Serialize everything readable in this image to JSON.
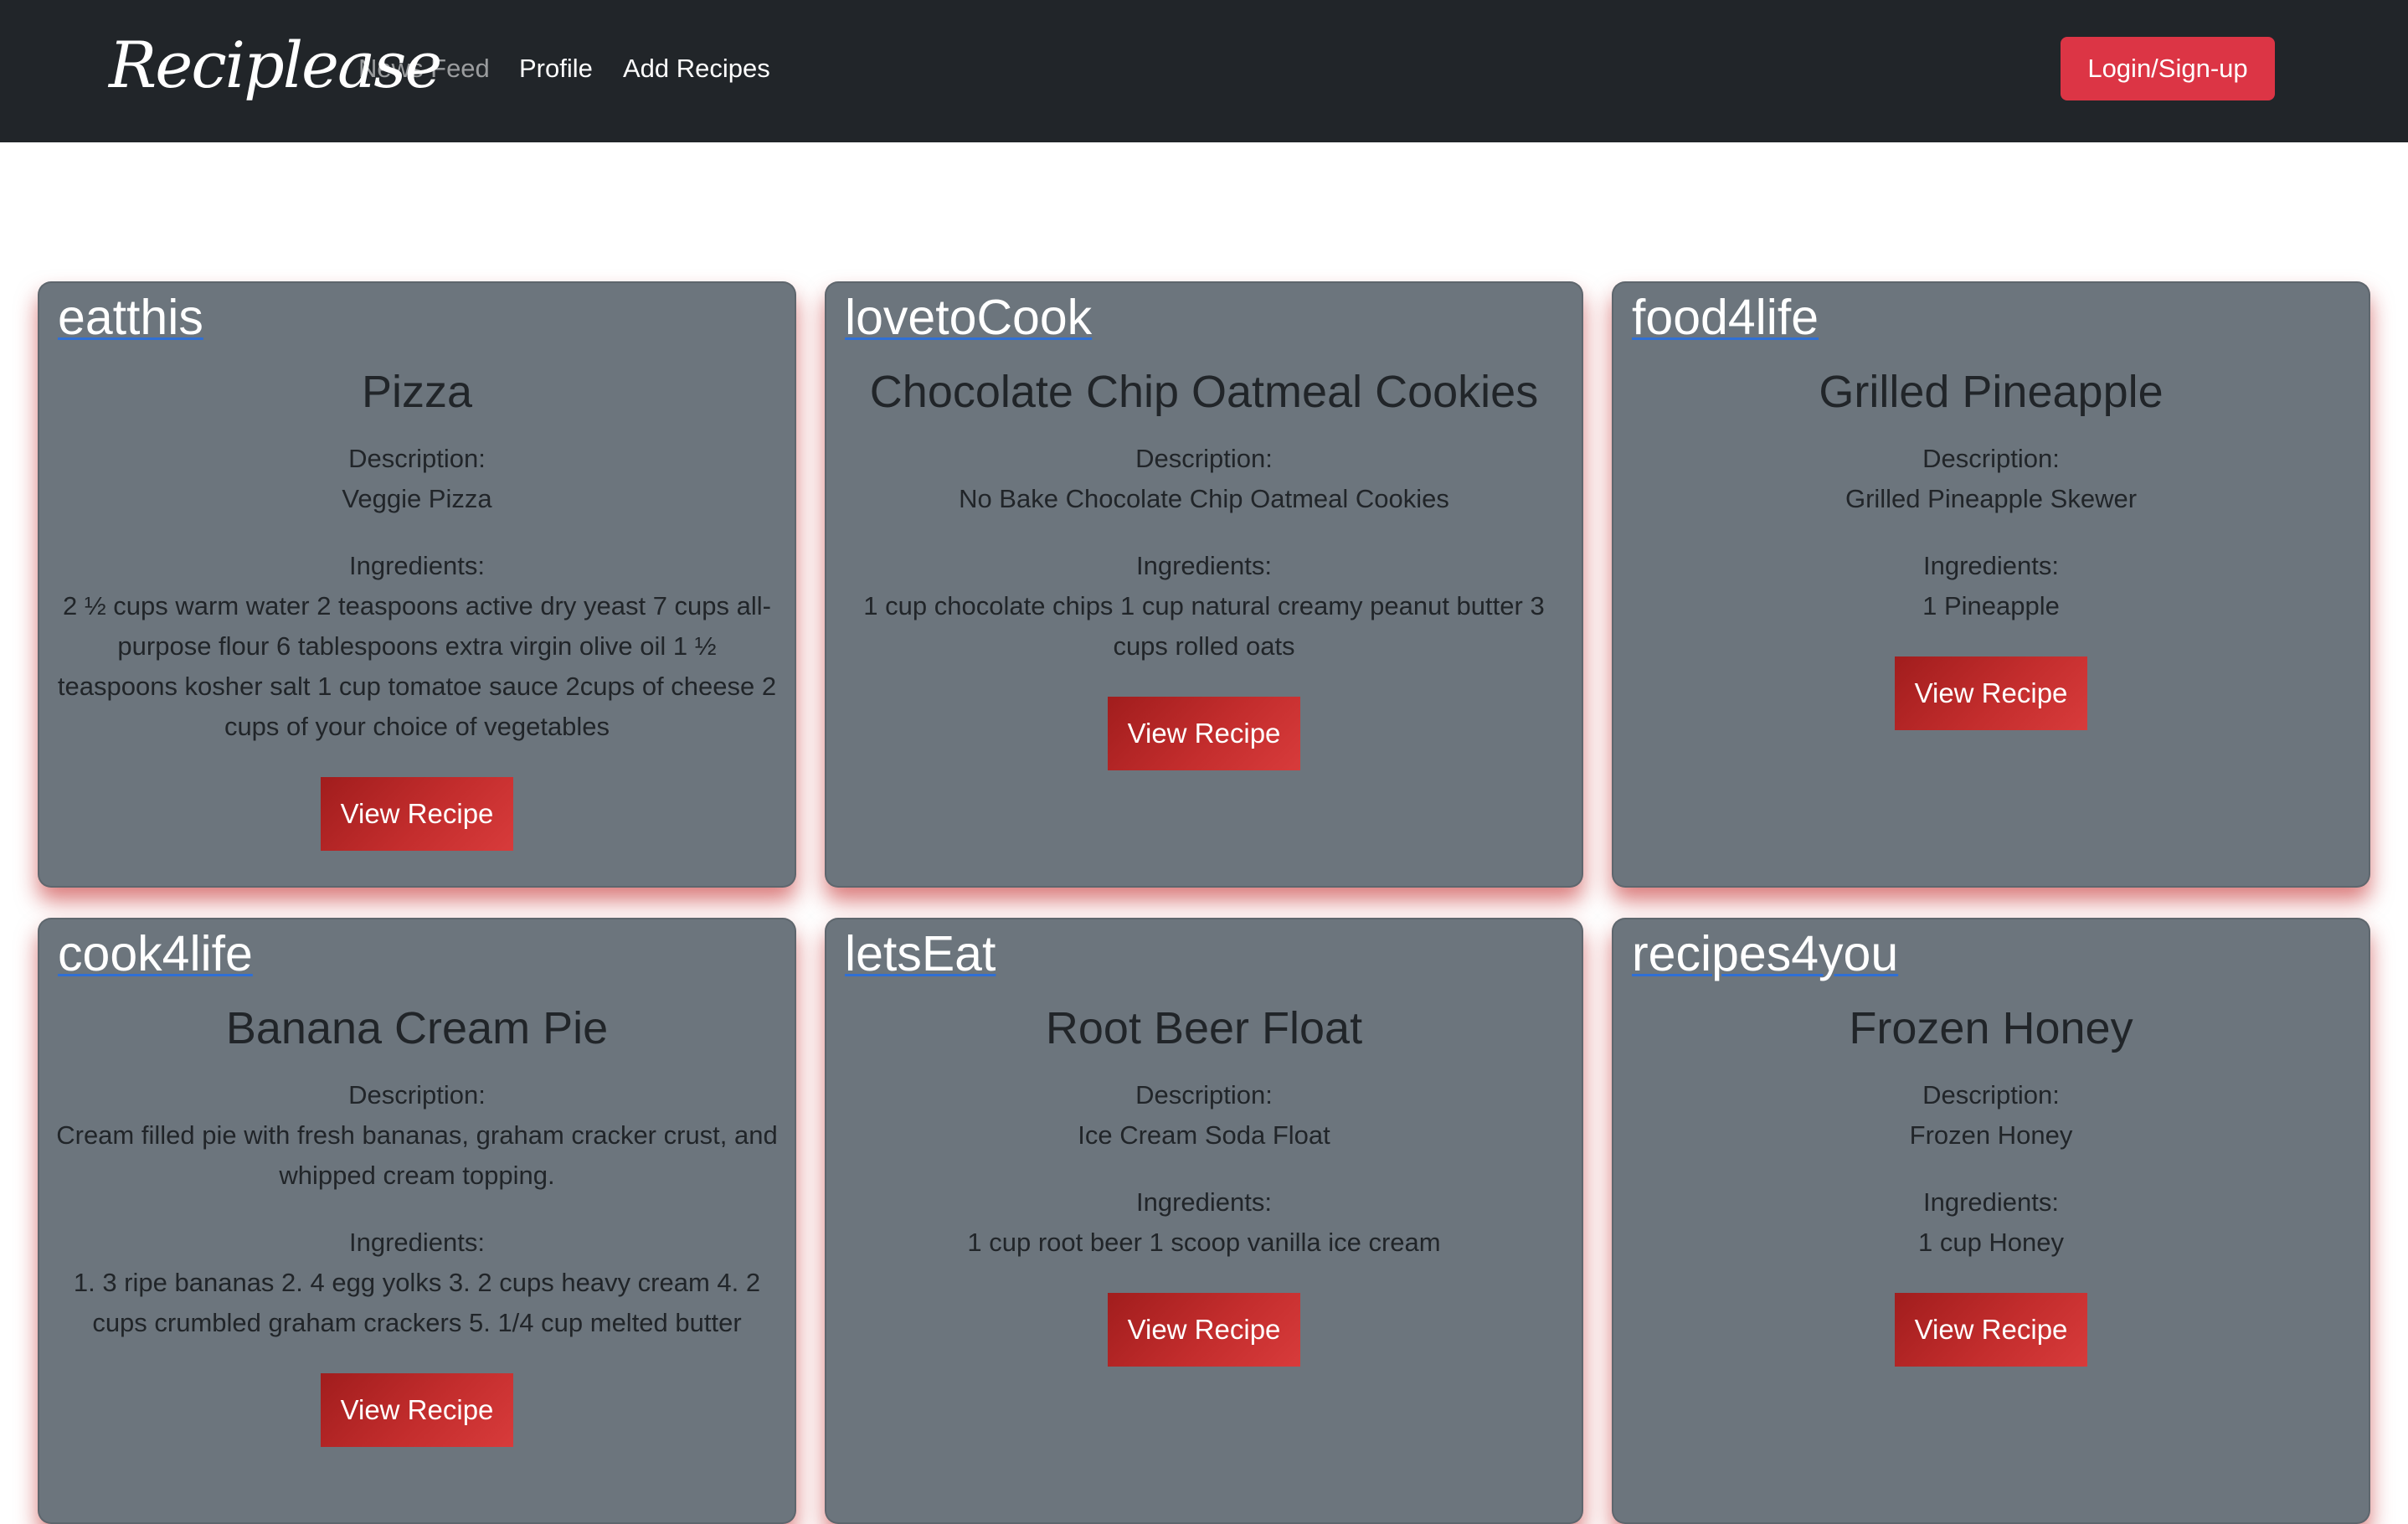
{
  "nav": {
    "brand": "Reciplease",
    "links": [
      "News Feed",
      "Profile",
      "Add Recipes"
    ],
    "login": "Login/Sign-up"
  },
  "labels": {
    "description": "Description:",
    "ingredients": "Ingredients:",
    "view_button": "View Recipe"
  },
  "cards": [
    {
      "user": "eatthis",
      "title": "Pizza",
      "description": "Veggie Pizza",
      "ingredients": "2 ½ cups warm water 2 teaspoons active dry yeast 7 cups all-purpose flour 6 tablespoons extra virgin olive oil 1 ½ teaspoons kosher salt 1 cup tomatoe sauce 2cups of cheese 2 cups of your choice of vegetables"
    },
    {
      "user": "lovetoCook",
      "title": "Chocolate Chip Oatmeal Cookies",
      "description": "No Bake Chocolate Chip Oatmeal Cookies",
      "ingredients": "1 cup chocolate chips 1 cup natural creamy peanut butter 3 cups rolled oats"
    },
    {
      "user": "food4life",
      "title": "Grilled Pineapple",
      "description": "Grilled Pineapple Skewer",
      "ingredients": "1 Pineapple"
    },
    {
      "user": "cook4life",
      "title": "Banana Cream Pie",
      "description": "Cream filled pie with fresh bananas, graham cracker crust, and whipped cream topping.",
      "ingredients": "1. 3 ripe bananas 2. 4 egg yolks 3. 2 cups heavy cream 4. 2 cups crumbled graham crackers 5. 1/4 cup melted butter"
    },
    {
      "user": "letsEat",
      "title": "Root Beer Float",
      "description": "Ice Cream Soda Float",
      "ingredients": "1 cup root beer 1 scoop vanilla ice cream"
    },
    {
      "user": "recipes4you",
      "title": "Frozen Honey",
      "description": "Frozen Honey",
      "ingredients": "1 cup Honey"
    }
  ]
}
